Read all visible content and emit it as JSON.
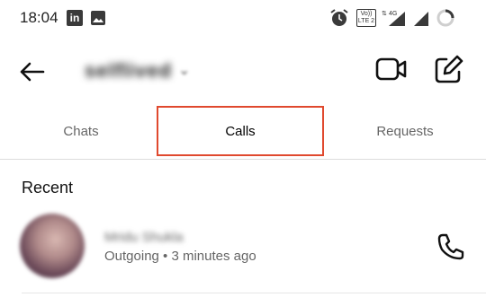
{
  "status_bar": {
    "time": "18:04",
    "linkedin_label": "in",
    "volte_label": "Vo)) LTE 2",
    "network_label": "4G"
  },
  "header": {
    "account_name": "selflived",
    "chevron": "⌄"
  },
  "tabs": [
    {
      "label": "Chats"
    },
    {
      "label": "Calls"
    },
    {
      "label": "Requests"
    }
  ],
  "recent": {
    "title": "Recent",
    "calls": [
      {
        "name": "Mridu Shukla",
        "meta": "Outgoing • 3 minutes ago"
      }
    ]
  },
  "colors": {
    "highlight": "#e0492e",
    "divider": "#dcdcdc"
  }
}
